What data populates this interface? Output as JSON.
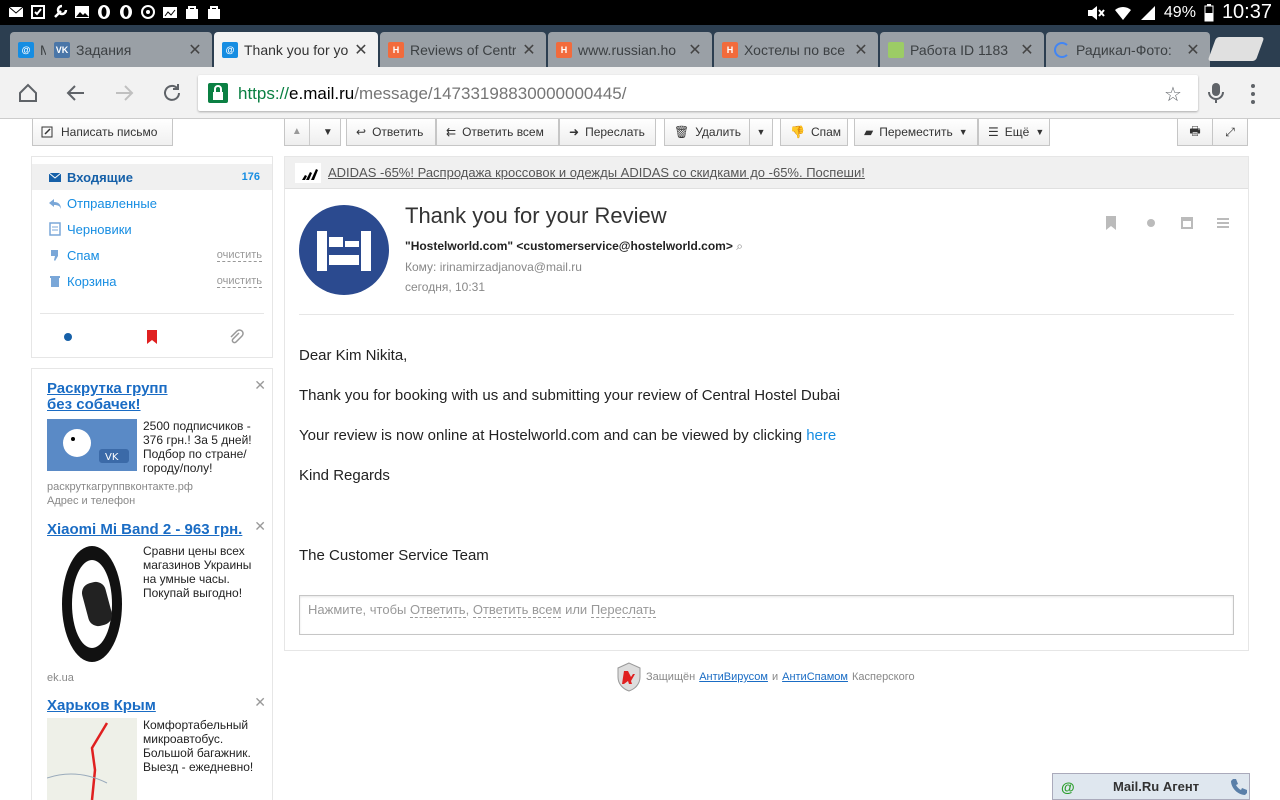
{
  "status_bar": {
    "battery": "49%",
    "time": "10:37"
  },
  "tabs": [
    {
      "title": "M",
      "favicon": "mailru-icon",
      "color": "#168de2"
    },
    {
      "title": "Задания",
      "favicon": "vk-icon",
      "color": "#4a76a8"
    },
    {
      "title": "Thank you for yo",
      "favicon": "mailru-icon",
      "color": "#168de2",
      "active": true
    },
    {
      "title": "Reviews of Centr",
      "favicon": "hostelworld-icon",
      "color": "#f26b3c"
    },
    {
      "title": "www.russian.ho",
      "favicon": "hostelworld-icon",
      "color": "#f26b3c"
    },
    {
      "title": "Хостелы по все",
      "favicon": "hostelworld-icon",
      "color": "#f26b3c"
    },
    {
      "title": "Работа ID 1183",
      "favicon": "pattern-icon",
      "color": "#9ccc65"
    },
    {
      "title": "Радикал-Фото:",
      "favicon": "loading-icon",
      "color": "#4285f4"
    }
  ],
  "url": {
    "scheme": "https://",
    "host": "e.mail.ru",
    "path": "/message/14733198830000000445/"
  },
  "compose_label": "Написать письмо",
  "folders": [
    {
      "label": "Входящие",
      "count": "176",
      "icon": "envelope-icon"
    },
    {
      "label": "Отправленные",
      "icon": "reply-icon"
    },
    {
      "label": "Черновики",
      "icon": "draft-icon"
    },
    {
      "label": "Спам",
      "clear": "очистить",
      "icon": "thumbs-down-icon"
    },
    {
      "label": "Корзина",
      "clear": "очистить",
      "icon": "trash-icon"
    }
  ],
  "mail_toolbar": {
    "reply": "Ответить",
    "reply_all": "Ответить всем",
    "forward": "Переслать",
    "delete": "Удалить",
    "spam": "Спам",
    "move": "Переместить",
    "more": "Ещё"
  },
  "promo": {
    "text": "ADIDAS -65%! Распродажа кроссовок и одежды ADIDAS со скидками до -65%. Поспеши!"
  },
  "message": {
    "subject": "Thank you for your Review",
    "from": "\"Hostelworld.com\" <customerservice@hostelworld.com>",
    "to": "Кому: irinamirzadjanova@mail.ru",
    "date": "сегодня, 10:31",
    "greeting": "Dear Kim Nikita,",
    "line1": "Thank you for booking with us and submitting your review of Central Hostel Dubai",
    "line2": "Your review is now online at Hostelworld.com and can be viewed by clicking",
    "link": "here",
    "regards": "Kind Regards",
    "signature": "The Customer Service Team"
  },
  "reply_box": {
    "prefix": "Нажмите, чтобы",
    "reply": "Ответить",
    "sep": ",",
    "reply_all": "Ответить всем",
    "or": "или",
    "forward": "Переслать"
  },
  "ads": [
    {
      "title": "Раскрутка групп без собачек!",
      "text": "2500 подписчиков - 376 грн.! За 5 дней! Подбор по стране/городу/полу!",
      "domain": "раскруткагруппвконтакте.рф",
      "extra": "Адрес и телефон"
    },
    {
      "title": "Xiaomi Mi Band 2 - 963 грн.",
      "text": "Сравни цены всех магазинов Украины на умные часы. Покупай выгодно!",
      "domain": "ek.ua"
    },
    {
      "title": "Харьков Крым",
      "text": "Комфортабельный микроавтобус. Большой багажник. Выезд - ежедневно!"
    }
  ],
  "kaspersky": {
    "prefix": "Защищён",
    "av": "АнтиВирусом",
    "and": "и",
    "as": "АнтиСпамом",
    "suffix": "Касперского"
  },
  "agent": {
    "at": "@",
    "label": "Mail.Ru Агент"
  }
}
